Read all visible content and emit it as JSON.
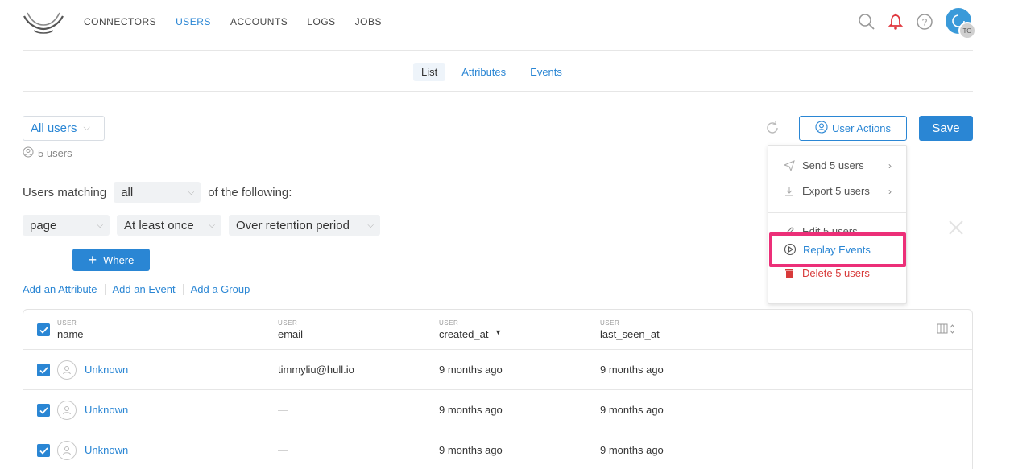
{
  "nav": {
    "links": [
      "CONNECTORS",
      "USERS",
      "ACCOUNTS",
      "LOGS",
      "JOBS"
    ],
    "active": "USERS",
    "avatar_initials": "TO",
    "icons": [
      "search-icon",
      "bell-icon",
      "help-icon"
    ]
  },
  "subtabs": [
    "List",
    "Attributes",
    "Events"
  ],
  "segment": {
    "selected": "All users",
    "count": "5 users"
  },
  "actions": {
    "user_actions": "User Actions",
    "save": "Save"
  },
  "dropdown": {
    "send": "Send 5 users",
    "export": "Export 5 users",
    "edit": "Edit 5 users",
    "replay": "Replay Events",
    "delete": "Delete 5 users"
  },
  "filters": {
    "users_matching": "Users matching",
    "mode": "all",
    "of_following": "of the following:",
    "event": "page",
    "frequency": "At least once",
    "period": "Over retention period",
    "where": "Where"
  },
  "add_links": [
    "Add an Attribute",
    "Add an Event",
    "Add a Group"
  ],
  "table": {
    "columns": [
      {
        "group": "USER",
        "name": "name"
      },
      {
        "group": "USER",
        "name": "email"
      },
      {
        "group": "USER",
        "name": "created_at"
      },
      {
        "group": "USER",
        "name": "last_seen_at"
      }
    ],
    "rows": [
      {
        "name": "Unknown",
        "email": "timmyliu@hull.io",
        "created_at": "9 months ago",
        "last_seen_at": "9 months ago"
      },
      {
        "name": "Unknown",
        "email": "—",
        "created_at": "9 months ago",
        "last_seen_at": "9 months ago"
      },
      {
        "name": "Unknown",
        "email": "—",
        "created_at": "9 months ago",
        "last_seen_at": "9 months ago"
      }
    ]
  },
  "colors": {
    "accent": "#2a86d4",
    "danger": "#d83a3a",
    "highlight": "#ec2f78"
  }
}
